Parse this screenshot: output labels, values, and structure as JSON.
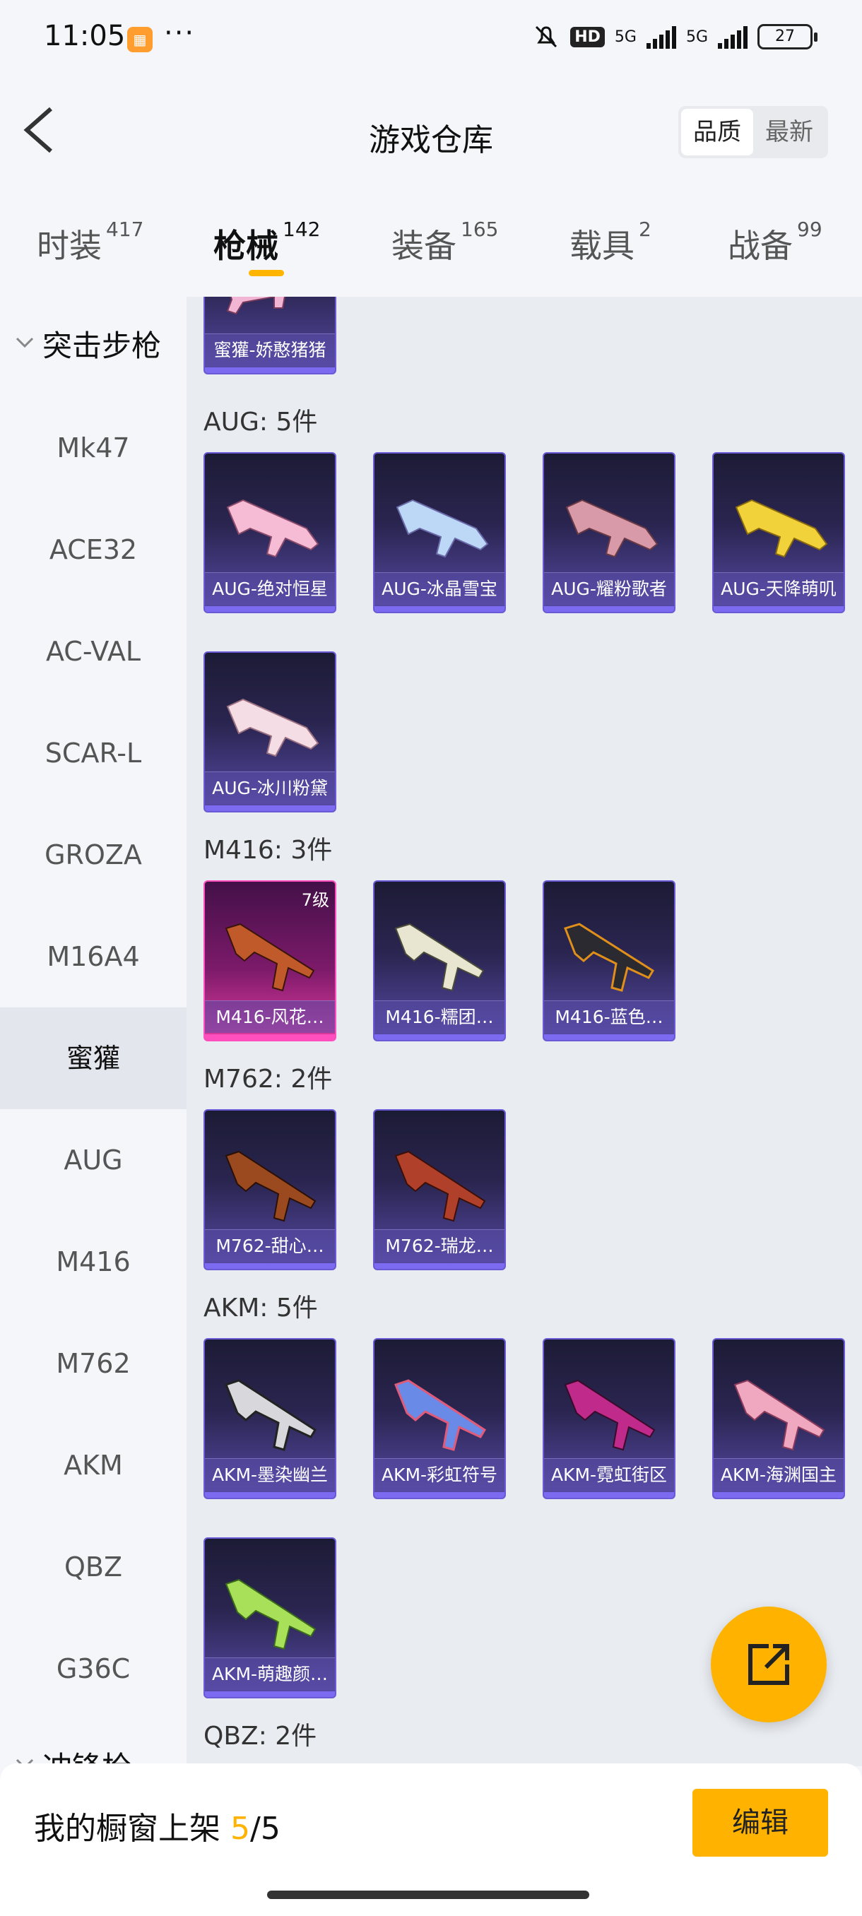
{
  "status": {
    "time": "11:05",
    "app_icon": "calendar-icon",
    "dots": "···",
    "hd": "HD",
    "net1": "5G",
    "net2": "5G",
    "battery": "27"
  },
  "header": {
    "title": "游戏仓库",
    "sort_options": [
      "品质",
      "最新"
    ],
    "active_sort": "品质"
  },
  "tabs": [
    {
      "label": "时装",
      "count": "417"
    },
    {
      "label": "枪械",
      "count": "142",
      "active": true
    },
    {
      "label": "装备",
      "count": "165"
    },
    {
      "label": "载具",
      "count": "2"
    },
    {
      "label": "战备",
      "count": "99"
    }
  ],
  "sidebar": {
    "group_top": "突击步枪",
    "items": [
      "Mk47",
      "ACE32",
      "AC-VAL",
      "SCAR-L",
      "GROZA",
      "M16A4",
      "蜜獾",
      "AUG",
      "M416",
      "M762",
      "AKM",
      "QBZ",
      "G36C"
    ],
    "active_item": "蜜獾",
    "group_bottom": "冲锋枪"
  },
  "content": {
    "top_card": {
      "label": "蜜獾-娇憨猪猪"
    },
    "sections": [
      {
        "title": "AUG: 5件",
        "items": [
          "AUG-绝对恒星",
          "AUG-冰晶雪宝",
          "AUG-耀粉歌者",
          "AUG-天降萌叽",
          "AUG-冰川粉黛"
        ]
      },
      {
        "title": "M416: 3件",
        "items": [
          "M416-风花…",
          "M416-糯团…",
          "M416-蓝色…"
        ],
        "first_level": "7级"
      },
      {
        "title": "M762: 2件",
        "items": [
          "M762-甜心…",
          "M762-瑞龙…"
        ]
      },
      {
        "title": "AKM: 5件",
        "items": [
          "AKM-墨染幽兰",
          "AKM-彩虹符号",
          "AKM-霓虹街区",
          "AKM-海渊国主",
          "AKM-萌趣颜…"
        ]
      },
      {
        "title": "QBZ: 2件",
        "items": []
      }
    ]
  },
  "bottom": {
    "label": "我的橱窗上架 ",
    "current": "5",
    "sep_total": "/5",
    "edit": "编辑"
  },
  "colors": {
    "accent": "#ffb300",
    "card_purple": "#584aa8",
    "card_pink": "#e13c9e"
  }
}
